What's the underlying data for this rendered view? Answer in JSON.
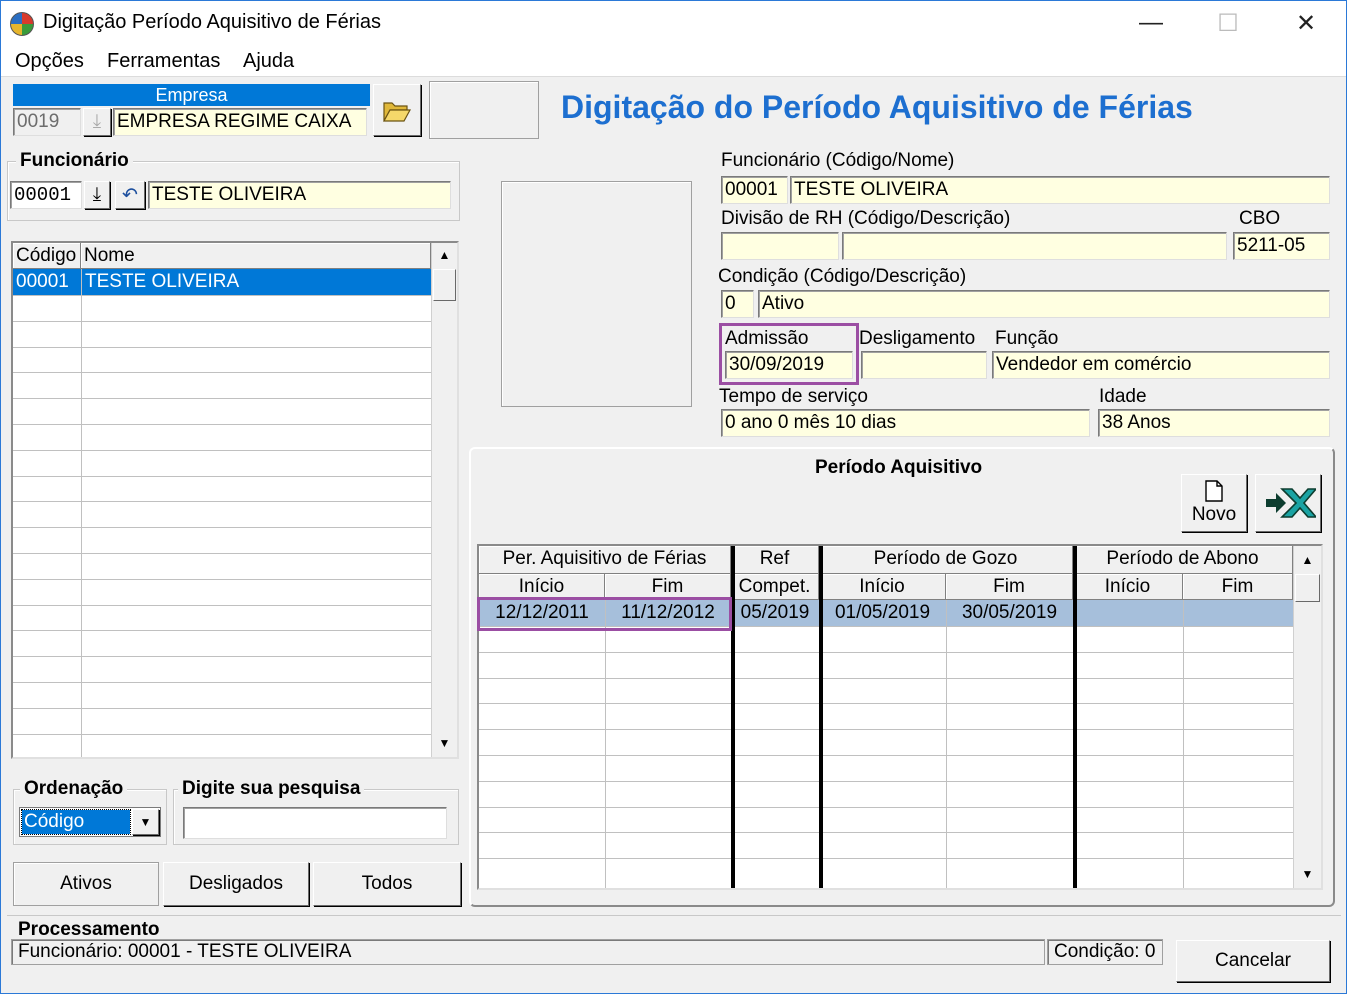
{
  "window": {
    "title": "Digitação Período Aquisitivo de Férias",
    "minimize": "—",
    "maximize": "☐",
    "close": "✕"
  },
  "menu": [
    "Opções",
    "Ferramentas",
    "Ajuda"
  ],
  "empresa": {
    "header": "Empresa",
    "code": "0019",
    "name": "EMPRESA REGIME CAIXA"
  },
  "heading": "Digitação do Período Aquisitivo de Férias",
  "funcionario_group": {
    "title": "Funcionário",
    "code": "00001",
    "name": "TESTE OLIVEIRA"
  },
  "employee_list": {
    "columns": [
      "Código",
      "Nome"
    ],
    "rows": [
      {
        "code": "00001",
        "name": "TESTE OLIVEIRA"
      }
    ]
  },
  "ordenacao": {
    "title": "Ordenação",
    "selected": "Código"
  },
  "pesquisa": {
    "title": "Digite sua pesquisa",
    "value": ""
  },
  "tabs": [
    "Ativos",
    "Desligados",
    "Todos"
  ],
  "details": {
    "funcionario_label": "Funcionário (Código/Nome)",
    "funcionario_code": "00001",
    "funcionario_name": "TESTE OLIVEIRA",
    "divisao_label": "Divisão de RH (Código/Descrição)",
    "divisao_code": "",
    "divisao_desc": "",
    "cbo_label": "CBO",
    "cbo_value": "5211-05",
    "condicao_label": "Condição (Código/Descrição)",
    "condicao_code": "0",
    "condicao_desc": "Ativo",
    "admissao_label": "Admissão",
    "admissao_value": "30/09/2019",
    "desligamento_label": "Desligamento",
    "desligamento_value": "",
    "funcao_label": "Função",
    "funcao_value": "Vendedor em comércio",
    "tempo_label": "Tempo de serviço",
    "tempo_value": "0 ano 0 mês 10 dias",
    "idade_label": "Idade",
    "idade_value": "38 Anos"
  },
  "periodo": {
    "title": "Período Aquisitivo",
    "novo_label": "Novo",
    "group_headers": [
      "Per. Aquisitivo de Férias",
      "Ref",
      "Período de Gozo",
      "Período de Abono"
    ],
    "sub_headers": [
      "Início",
      "Fim",
      "Compet.",
      "Início",
      "Fim",
      "Início",
      "Fim"
    ],
    "rows": [
      {
        "aq_inicio": "12/12/2011",
        "aq_fim": "11/12/2012",
        "compet": "05/2019",
        "gozo_inicio": "01/05/2019",
        "gozo_fim": "30/05/2019",
        "abono_inicio": "",
        "abono_fim": ""
      }
    ]
  },
  "processamento": {
    "title": "Processamento",
    "status": "Funcionário: 00001 - TESTE OLIVEIRA",
    "condicao": "Condição: 0",
    "cancel_label": "Cancelar"
  },
  "colors": {
    "accent": "#0078d7",
    "heading": "#1d6fd0",
    "field_bg": "#ffffe1",
    "highlight_box": "#9b4ea3",
    "selected_row": "#a6bfdb"
  }
}
